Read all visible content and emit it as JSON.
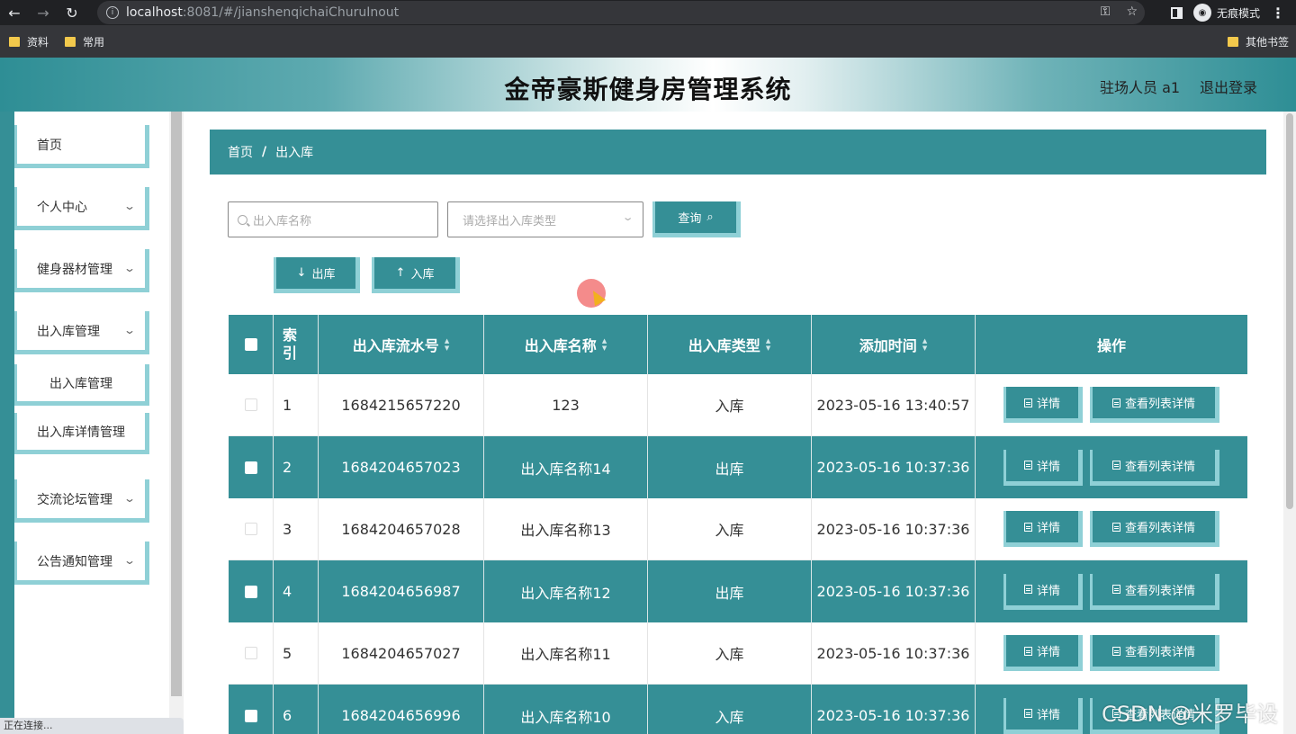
{
  "browser": {
    "url_host": "localhost",
    "url_rest": ":8081/#/jianshenqichaiChuruInout",
    "incognito_label": "无痕模式",
    "bookmarks": [
      "资料",
      "常用"
    ],
    "bookmarks_right": "其他书签",
    "status": "正在连接..."
  },
  "header": {
    "title": "金帝豪斯健身房管理系统",
    "user": "驻场人员 a1",
    "logout": "退出登录"
  },
  "sidebar": {
    "items": [
      {
        "label": "首页",
        "has_chevron": false
      },
      {
        "label": "个人中心",
        "has_chevron": true
      },
      {
        "label": "健身器材管理",
        "has_chevron": true
      },
      {
        "label": "出入库管理",
        "has_chevron": true
      },
      {
        "label": "交流论坛管理",
        "has_chevron": true
      },
      {
        "label": "公告通知管理",
        "has_chevron": true
      }
    ],
    "subitems": [
      "出入库管理",
      "出入库详情管理"
    ]
  },
  "breadcrumb": {
    "home": "首页",
    "separator": "/",
    "current": "出入库"
  },
  "search": {
    "name_placeholder": "出入库名称",
    "type_placeholder": "请选择出入库类型",
    "query_label": "查询"
  },
  "actions": {
    "out_label": "出库",
    "in_label": "入库"
  },
  "table": {
    "headers": {
      "index_line1": "索",
      "index_line2": "引",
      "serial": "出入库流水号",
      "name": "出入库名称",
      "type": "出入库类型",
      "time": "添加时间",
      "ops": "操作"
    },
    "detail_label": "详情",
    "list_detail_label": "查看列表详情",
    "rows": [
      {
        "index": "1",
        "serial": "1684215657220",
        "name": "123",
        "type": "入库",
        "time": "2023-05-16 13:40:57"
      },
      {
        "index": "2",
        "serial": "1684204657023",
        "name": "出入库名称14",
        "type": "出库",
        "time": "2023-05-16 10:37:36"
      },
      {
        "index": "3",
        "serial": "1684204657028",
        "name": "出入库名称13",
        "type": "入库",
        "time": "2023-05-16 10:37:36"
      },
      {
        "index": "4",
        "serial": "1684204656987",
        "name": "出入库名称12",
        "type": "出库",
        "time": "2023-05-16 10:37:36"
      },
      {
        "index": "5",
        "serial": "1684204657027",
        "name": "出入库名称11",
        "type": "入库",
        "time": "2023-05-16 10:37:36"
      },
      {
        "index": "6",
        "serial": "1684204656996",
        "name": "出入库名称10",
        "type": "入库",
        "time": "2023-05-16 10:37:36"
      }
    ]
  },
  "watermark": "CSDN @米罗毕设",
  "colors": {
    "accent": "#358f96",
    "accent_light": "#8fd0d6"
  }
}
